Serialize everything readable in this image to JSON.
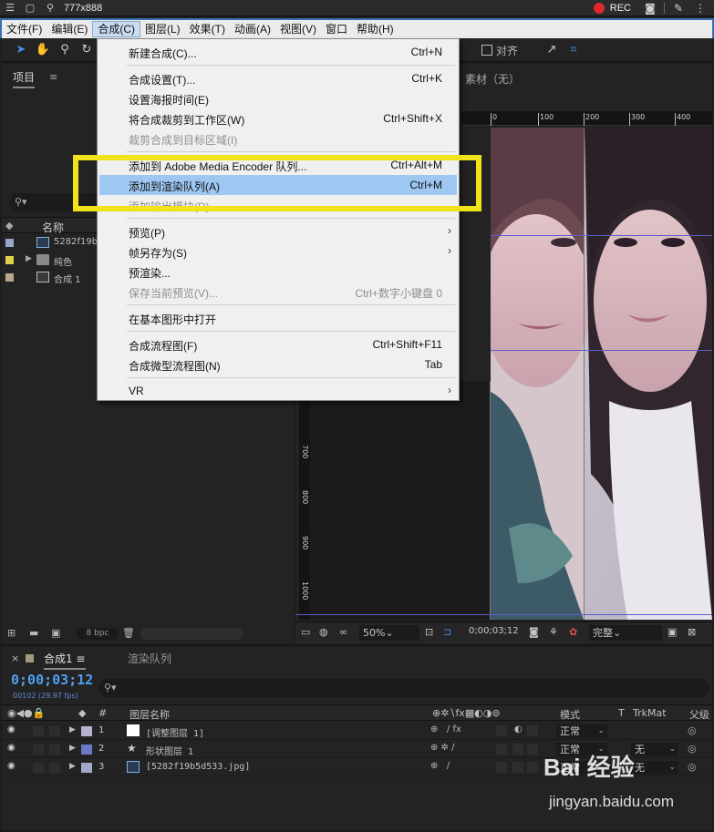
{
  "capture_bar": {
    "size_label": "777x888",
    "rec_label": "REC"
  },
  "menubar": {
    "items": [
      "文件(F)",
      "编辑(E)",
      "合成(C)",
      "图层(L)",
      "效果(T)",
      "动画(A)",
      "视图(V)",
      "窗口",
      "帮助(H)"
    ],
    "active_index": 2
  },
  "toolbar": {
    "snap_label": "对齐"
  },
  "project_panel": {
    "tab_label": "项目",
    "search_placeholder": "",
    "column_name": "名称",
    "items": [
      {
        "label": "5282f19b",
        "icon": "image-file-icon",
        "color": "#9aa6c8"
      },
      {
        "label": "纯色",
        "icon": "folder-icon",
        "color": "#e2d24a"
      },
      {
        "label": "合成 1",
        "icon": "composition-icon",
        "color": "#b8a68a"
      }
    ],
    "bpc_label": "8 bpc"
  },
  "viewer": {
    "footage_tab_label": "素材（无）",
    "ruler_top_ticks": [
      "0",
      "100",
      "200",
      "300",
      "400"
    ],
    "ruler_left_ticks": [
      "700",
      "800",
      "900",
      "1000"
    ],
    "zoom": "50%",
    "timecode": "0;00;03;12",
    "resolution": "完整"
  },
  "composition_menu": {
    "items": [
      {
        "label": "新建合成(C)...",
        "shortcut": "Ctrl+N",
        "disabled": false
      },
      {
        "label": "合成设置(T)...",
        "shortcut": "Ctrl+K",
        "disabled": false
      },
      {
        "label": "设置海报时间(E)",
        "shortcut": "",
        "disabled": false
      },
      {
        "label": "将合成裁剪到工作区(W)",
        "shortcut": "Ctrl+Shift+X",
        "disabled": false
      },
      {
        "label": "裁剪合成到目标区域(I)",
        "shortcut": "",
        "disabled": true
      },
      {
        "label": "添加到 Adobe Media Encoder 队列...",
        "shortcut": "Ctrl+Alt+M",
        "disabled": false
      },
      {
        "label": "添加到渲染队列(A)",
        "shortcut": "Ctrl+M",
        "disabled": false,
        "selected": true
      },
      {
        "label": "添加输出模块(D)",
        "shortcut": "",
        "disabled": true
      },
      {
        "label": "预览(P)",
        "shortcut": "",
        "disabled": false,
        "submenu": true
      },
      {
        "label": "帧另存为(S)",
        "shortcut": "",
        "disabled": false,
        "submenu": true
      },
      {
        "label": "预渲染...",
        "shortcut": "",
        "disabled": false
      },
      {
        "label": "保存当前预览(V)...",
        "shortcut": "Ctrl+数字小键盘 0",
        "disabled": true
      },
      {
        "label": "在基本图形中打开",
        "shortcut": "",
        "disabled": false
      },
      {
        "label": "合成流程图(F)",
        "shortcut": "Ctrl+Shift+F11",
        "disabled": false
      },
      {
        "label": "合成微型流程图(N)",
        "shortcut": "Tab",
        "disabled": false
      },
      {
        "label": "VR",
        "shortcut": "",
        "disabled": false,
        "submenu": true
      }
    ]
  },
  "timeline": {
    "comp_tab_label": "合成1",
    "render_tab_label": "渲染队列",
    "timecode": "0;00;03;12",
    "frame_info": "00102 (29.97 fps)",
    "col_layer_name": "图层名称",
    "col_mode": "模式",
    "col_t": "T",
    "col_trkmat": "TrkMat",
    "col_parent": "父级",
    "layers": [
      {
        "num": "1",
        "name": "[调整图层 1]",
        "mode": "正常",
        "trkmat": "",
        "color": "#b7b3cf",
        "icon": "adjustment-layer-icon"
      },
      {
        "num": "2",
        "name": "形状图层 1",
        "mode": "正常",
        "trkmat": "无",
        "color": "#6a78c8",
        "icon": "star-shape-icon"
      },
      {
        "num": "3",
        "name": "[5282f19b5d533.jpg]",
        "mode": "正常",
        "trkmat": "无",
        "color": "#a2a8c8",
        "icon": "image-file-icon"
      }
    ]
  },
  "watermark": {
    "line1": "Bai 经验",
    "line2": "jingyan.baidu.com"
  },
  "colors": {
    "highlight_box": "#f1e21a",
    "menu_selected": "#9ec8f2",
    "timecode": "#4fa0f0"
  }
}
